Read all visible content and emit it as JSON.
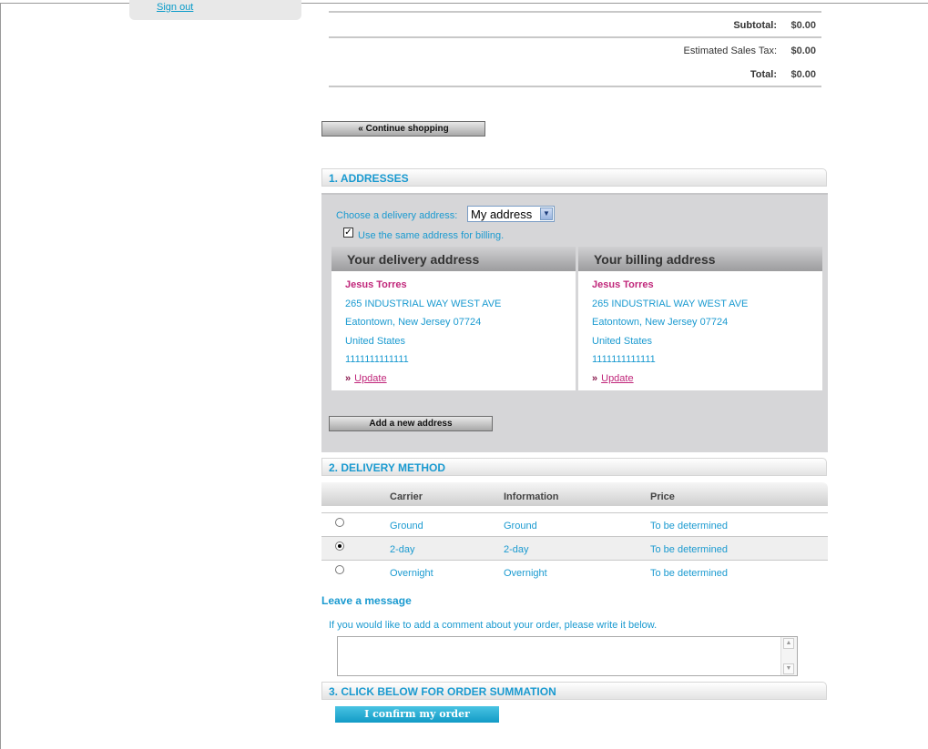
{
  "account": {
    "sign_out": "Sign out"
  },
  "totals": {
    "rows": [
      {
        "label": "Subtotal:",
        "value": "$0.00"
      },
      {
        "label": "Estimated Sales Tax:",
        "value": "$0.00"
      },
      {
        "label": "Total:",
        "value": "$0.00"
      }
    ]
  },
  "continue_shopping": "« Continue shopping",
  "addresses": {
    "title": "1. ADDRESSES",
    "choose_label": "Choose a delivery address:",
    "selected_address": "My address",
    "same_billing_label": "Use the same address for billing.",
    "same_billing_checked": "✓",
    "delivery": {
      "header": "Your delivery address",
      "name": "Jesus Torres",
      "street": "265 INDUSTRIAL WAY WEST AVE",
      "city": "Eatontown, New Jersey 07724",
      "country": "United States",
      "phone": "1111111111111",
      "update": "Update"
    },
    "billing": {
      "header": "Your billing address",
      "name": "Jesus Torres",
      "street": "265 INDUSTRIAL WAY WEST AVE",
      "city": "Eatontown, New Jersey 07724",
      "country": "United States",
      "phone": "1111111111111",
      "update": "Update"
    },
    "add_new": "Add a new address"
  },
  "delivery_method": {
    "title": "2. DELIVERY METHOD",
    "headers": {
      "carrier": "Carrier",
      "information": "Information",
      "price": "Price"
    },
    "rows": [
      {
        "carrier": "Ground",
        "information": "Ground",
        "price": "To be determined"
      },
      {
        "carrier": "2-day",
        "information": "2-day",
        "price": "To be determined"
      },
      {
        "carrier": "Overnight",
        "information": "Overnight",
        "price": "To be determined"
      }
    ]
  },
  "message": {
    "title": "Leave a message",
    "hint": "If you would like to add a comment about your order, please write it below.",
    "value": ""
  },
  "summation": {
    "title": "3. CLICK BELOW FOR ORDER SUMMATION",
    "confirm": "I confirm my order"
  }
}
